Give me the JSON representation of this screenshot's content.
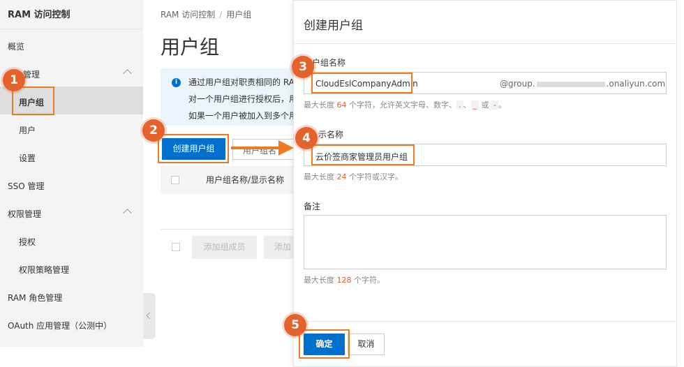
{
  "sidebar": {
    "title": "RAM 访问控制",
    "overview": "概览",
    "identity_group": "管理",
    "user_groups": "用户组",
    "users": "用户",
    "settings": "设置",
    "sso": "SSO 管理",
    "permission_group": "权限管理",
    "grant": "授权",
    "policy": "权限策略管理",
    "ram_role": "RAM 角色管理",
    "oauth": "OAuth 应用管理（公测中）"
  },
  "page": {
    "breadcrumb_root": "RAM 访问控制",
    "breadcrumb_sep": "/",
    "breadcrumb_current": "用户组",
    "title": "用户组",
    "info_line1": "通过用户组对职责相同的 RA",
    "info_line2": "对一个用户组进行授权后，用",
    "info_line3": "如果一个用户被加入到多个用",
    "create_button": "创建用户组",
    "search_placeholder": "用户组名",
    "column_name": "用户组名称/显示名称",
    "add_member_button": "添加组成员",
    "add_button_partial": "添加"
  },
  "modal": {
    "title": "创建用户组",
    "group_name_label": "用户组名称",
    "group_name_value": "CloudEslCompanyAdmin",
    "domain_prefix": "@group.",
    "domain_suffix": ".onaliyun.com",
    "group_name_hint_pre": "最大长度",
    "group_name_hint_num": "64",
    "group_name_hint_post": "个字符，允许英文字母、数字、",
    "hint_code1": ".",
    "hint_sep": "、",
    "hint_code2": "_",
    "hint_or": "或",
    "hint_code3": "-",
    "hint_end": "。",
    "display_name_label": "显示名称",
    "display_name_label_visible": "示名称",
    "display_name_value": "云价签商家管理员用户组",
    "display_name_hint_pre": "最大长度",
    "display_name_hint_num": "24",
    "display_name_hint_post": "个字符或汉字。",
    "remark_label": "备注",
    "remark_hint_pre": "最大长度",
    "remark_hint_num": "128",
    "remark_hint_post": "个字符。",
    "ok_button": "确定",
    "cancel_button": "取消"
  },
  "annotations": {
    "step1": "1",
    "step2": "2",
    "step3": "3",
    "step4": "4",
    "step5": "5"
  },
  "colors": {
    "primary": "#0070cc",
    "annotation": "#e4622c",
    "highlight": "#f07a21"
  }
}
